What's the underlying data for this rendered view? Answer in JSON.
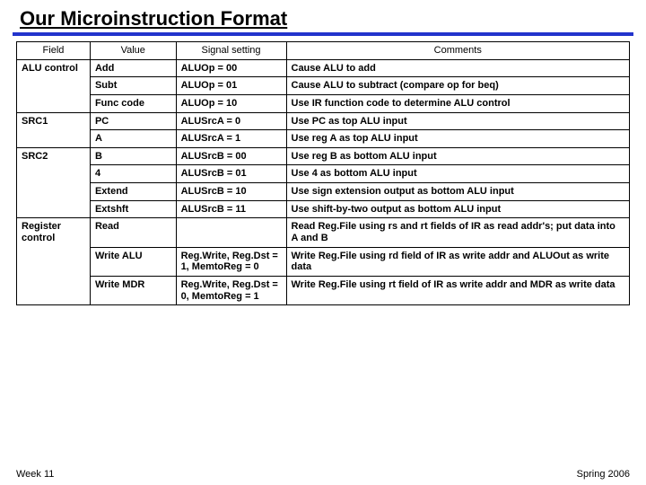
{
  "title": "Our Microinstruction Format",
  "headers": {
    "field": "Field",
    "value": "Value",
    "signal": "Signal setting",
    "comments": "Comments"
  },
  "rows": [
    {
      "field": "ALU control",
      "rowspan": 3,
      "value": "Add",
      "signal": "ALUOp = 00",
      "comment": "Cause ALU to add"
    },
    {
      "value": "Subt",
      "signal": "ALUOp = 01",
      "comment": "Cause ALU to subtract (compare op for beq)"
    },
    {
      "value": "Func code",
      "signal": "ALUOp = 10",
      "comment": "Use IR function code to determine ALU control"
    },
    {
      "field": "SRC1",
      "rowspan": 2,
      "value": "PC",
      "signal": "ALUSrcA = 0",
      "comment": "Use PC as top ALU input"
    },
    {
      "value": "A",
      "signal": "ALUSrcA = 1",
      "comment": "Use reg A as top ALU input"
    },
    {
      "field": "SRC2",
      "rowspan": 4,
      "value": "B",
      "signal": "ALUSrcB = 00",
      "comment": "Use reg B as bottom ALU input"
    },
    {
      "value": "4",
      "signal": "ALUSrcB = 01",
      "comment": "Use 4 as bottom ALU input"
    },
    {
      "value": "Extend",
      "signal": "ALUSrcB = 10",
      "comment": "Use sign extension output as bottom ALU input"
    },
    {
      "value": "Extshft",
      "signal": "ALUSrcB = 11",
      "comment": "Use shift-by-two output as bottom ALU input"
    },
    {
      "field": "Register control",
      "rowspan": 3,
      "value": "Read",
      "signal": "",
      "comment": "Read Reg.File using rs and rt fields of IR as read addr's; put data into A and B"
    },
    {
      "value": "Write ALU",
      "signal": "Reg.Write, Reg.Dst = 1, MemtoReg = 0",
      "comment": "Write Reg.File using rd field of IR as write addr and ALUOut as write data"
    },
    {
      "value": "Write MDR",
      "signal": "Reg.Write, Reg.Dst = 0, MemtoReg = 1",
      "comment": "Write Reg.File using rt field of IR as write addr and MDR as write data"
    }
  ],
  "footer": {
    "left": "Week 11",
    "right": "Spring 2006"
  }
}
